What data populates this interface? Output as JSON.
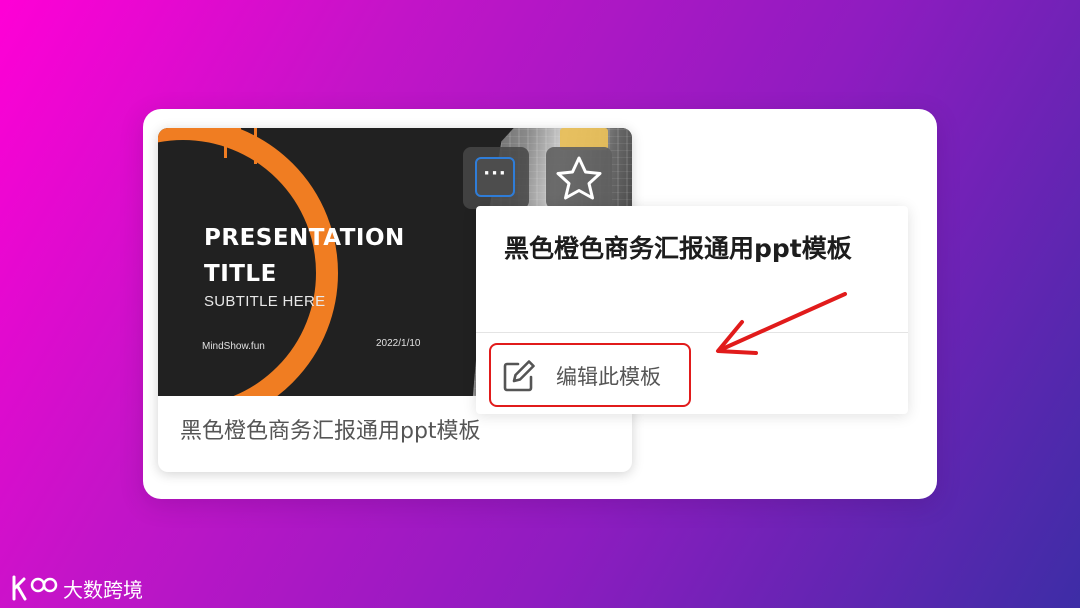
{
  "template_card": {
    "thumbnail": {
      "title": "PRESENTATION TITLE",
      "subtitle": "SUBTITLE HERE",
      "brand": "MindShow.fun",
      "date": "2022/1/10"
    },
    "caption": "黑色橙色商务汇报通用ppt模板",
    "more_button_label": "···",
    "more_button_icon": "more-dots-icon",
    "favorite_icon": "star-icon"
  },
  "popup_menu": {
    "title": "黑色橙色商务汇报通用ppt模板",
    "items": [
      {
        "label": "编辑此模板",
        "icon": "edit-pencil-icon"
      }
    ]
  },
  "watermark": {
    "logo_text": "K100",
    "text": "大数跨境"
  },
  "colors": {
    "accent_orange": "#f07d22",
    "highlight_red": "#e11b1b",
    "focus_blue": "#2f7dd8",
    "vip_gold": "#e8bf5a"
  }
}
